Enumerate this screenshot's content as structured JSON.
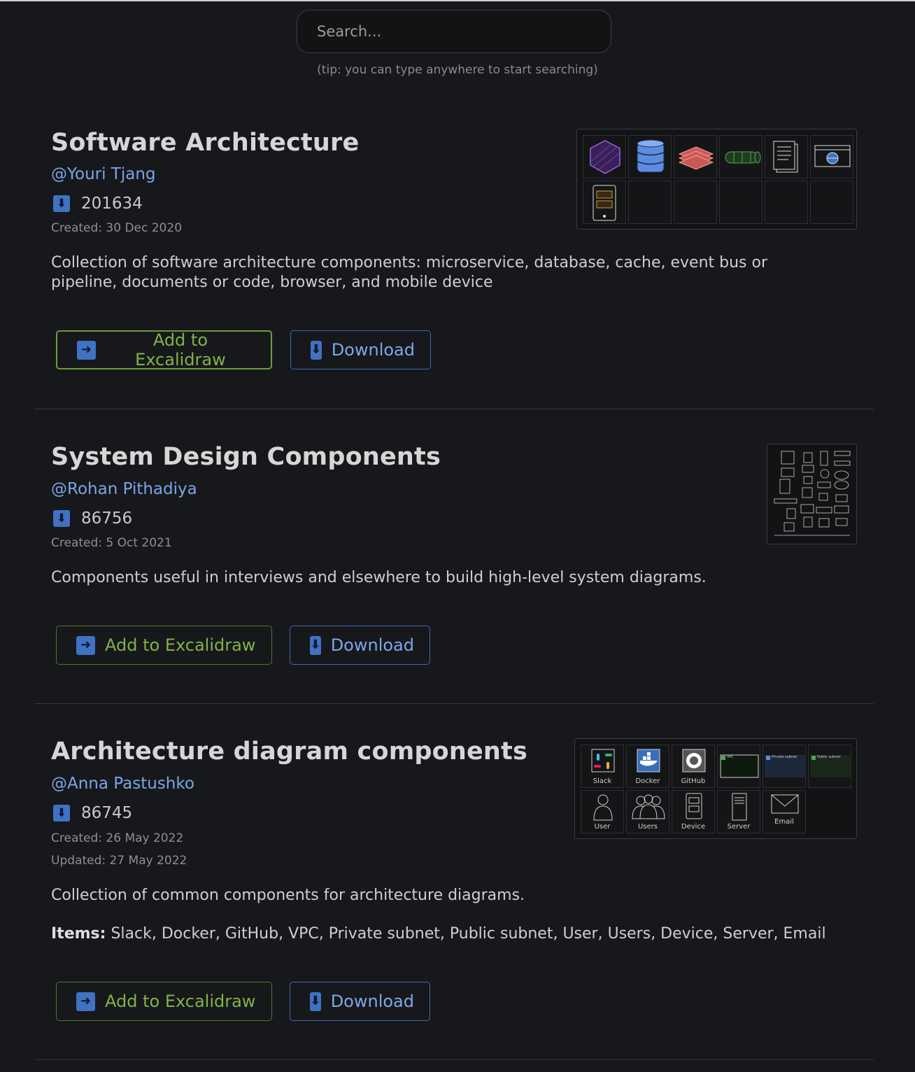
{
  "search": {
    "placeholder": "Search...",
    "tip": "(tip: you can type anywhere to start searching)"
  },
  "libraries": [
    {
      "title": "Software Architecture",
      "author": "@Youri Tjang",
      "downloads": "201634",
      "created": "Created: 30 Dec 2020",
      "description": "Collection of software architecture components: microservice, database, cache, event bus or pipeline, documents or code, browser, and mobile device",
      "add_label": "Add to Excalidraw",
      "download_label": "Download",
      "preview_icons": [
        "microservice-icon",
        "database-icon",
        "cache-icon",
        "event-bus-icon",
        "documents-icon",
        "browser-icon",
        "mobile-device-icon"
      ]
    },
    {
      "title": "System Design Components",
      "author": "@Rohan Pithadiya",
      "downloads": "86756",
      "created": "Created: 5 Oct 2021",
      "description": "Components useful in interviews and elsewhere to build high-level system diagrams.",
      "add_label": "Add to Excalidraw",
      "download_label": "Download"
    },
    {
      "title": "Architecture diagram components",
      "author": "@Anna Pastushko",
      "downloads": "86745",
      "created": "Created: 26 May 2022",
      "updated": "Updated: 27 May 2022",
      "description": "Collection of common components for architecture diagrams.",
      "items_label": "Items:",
      "items": "Slack, Docker, GitHub, VPC, Private subnet, Public subnet, User, Users, Device, Server, Email",
      "add_label": "Add to Excalidraw",
      "download_label": "Download",
      "preview_captions": [
        "Slack",
        "Docker",
        "GitHub",
        "VPC",
        "Private subnet",
        "Public subnet",
        "User",
        "Users",
        "Device",
        "Server",
        "Email"
      ]
    }
  ]
}
